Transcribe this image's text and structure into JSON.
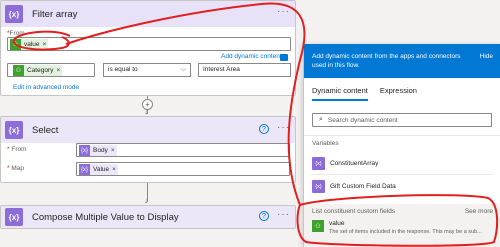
{
  "filter_card": {
    "icon_text": "{x}",
    "title": "Filter array",
    "more": "···",
    "from_label": "From",
    "from_token": "value",
    "add_dynamic": "Add dynamic content",
    "condition_token": "Category",
    "operator": "is equal to",
    "condition_value": "Interest Area",
    "edit_advanced": "Edit in advanced mode"
  },
  "select_card": {
    "icon_text": "{x}",
    "title": "Select",
    "help": "?",
    "more": "···",
    "from_label": "From",
    "from_token": "Body",
    "map_label": "Map",
    "map_token": "Value"
  },
  "compose_card": {
    "icon_text": "{x}",
    "title": "Compose Multiple Value to Display",
    "help": "?",
    "more": "···"
  },
  "flow": {
    "plus": "+"
  },
  "panel": {
    "header_text": "Add dynamic content from the apps and connectors used in this flow.",
    "hide": "Hide",
    "tabs": [
      {
        "label": "Dynamic content"
      },
      {
        "label": "Expression"
      }
    ],
    "search_placeholder": "Search dynamic content",
    "variables_label": "Variables",
    "variables": [
      {
        "label": "ConstituentArray",
        "icon_text": "{x}"
      },
      {
        "label": "Gift Custom Field Data",
        "icon_text": "{x}"
      }
    ],
    "custom_label": "List constituent custom fields",
    "see_more": "See more",
    "value_title": "value",
    "value_desc": "The set of items included in the response. This may be a sub..."
  },
  "colors": {
    "accent": "#0078d4",
    "variable_purple": "#8c6cd6",
    "connector_green": "#3da12c",
    "annotation_red": "#e02020"
  }
}
